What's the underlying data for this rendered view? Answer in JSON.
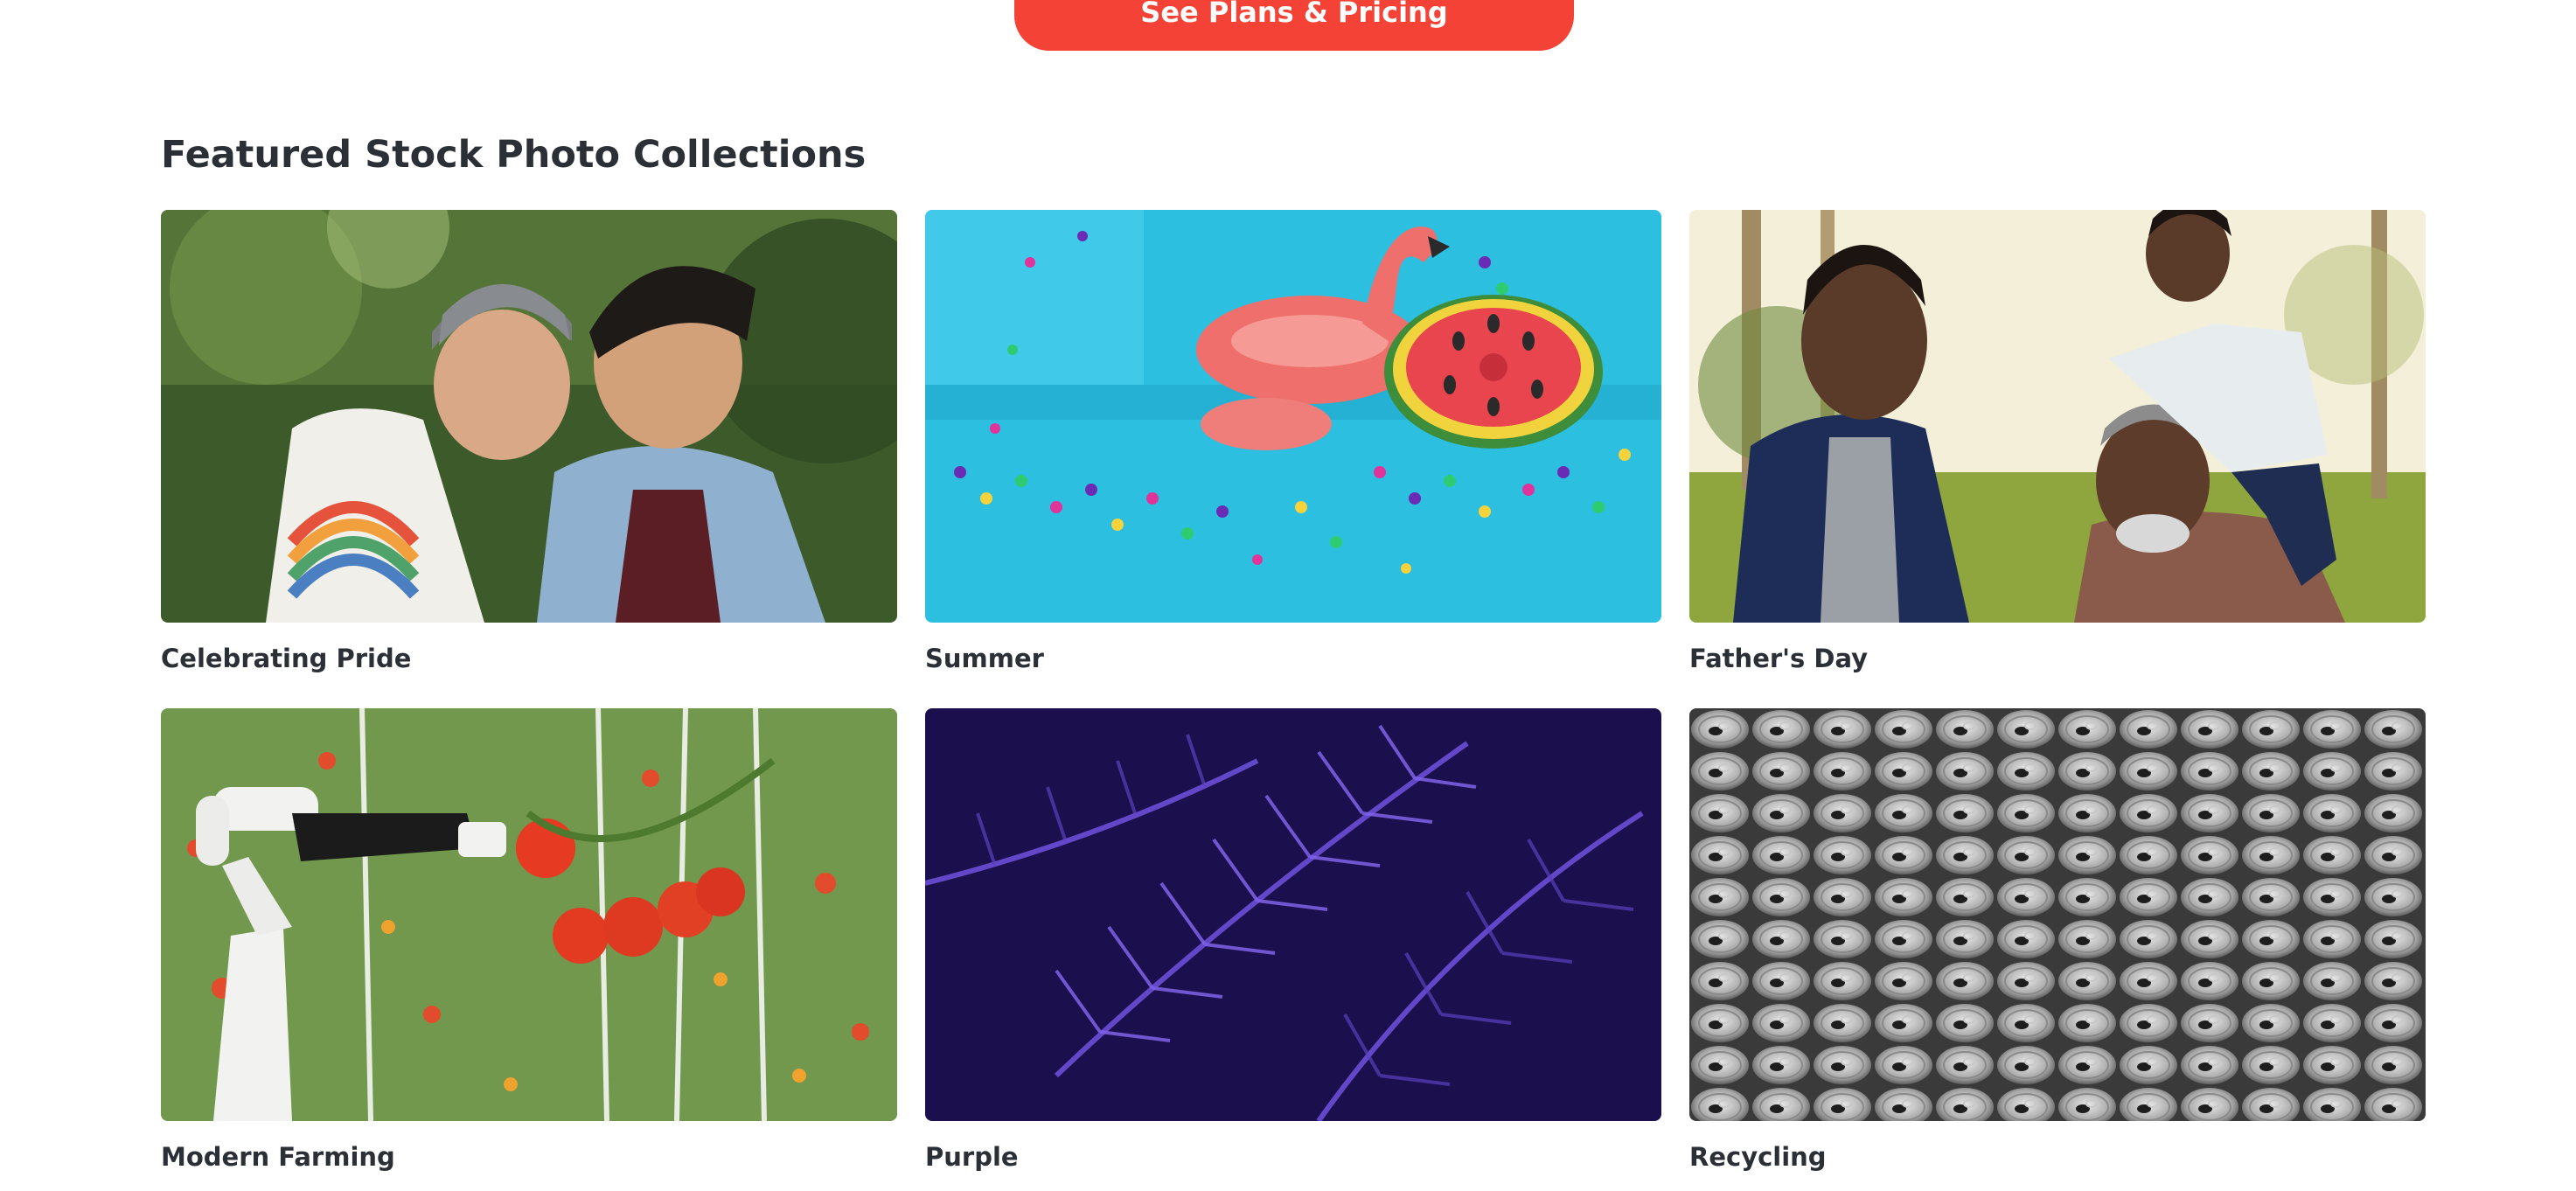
{
  "cta": {
    "label": "See Plans & Pricing",
    "color": "#f44336"
  },
  "section": {
    "title": "Featured Stock Photo Collections"
  },
  "collections": [
    {
      "label": "Celebrating Pride",
      "image": "couple-embracing-photo"
    },
    {
      "label": "Summer",
      "image": "pool-floaties-photo"
    },
    {
      "label": "Father's Day",
      "image": "father-son-grandfather-photo"
    },
    {
      "label": "Modern Farming",
      "image": "robot-arm-tomatoes-photo"
    },
    {
      "label": "Purple",
      "image": "purple-fern-photo"
    },
    {
      "label": "Recycling",
      "image": "aluminum-cans-photo"
    }
  ]
}
